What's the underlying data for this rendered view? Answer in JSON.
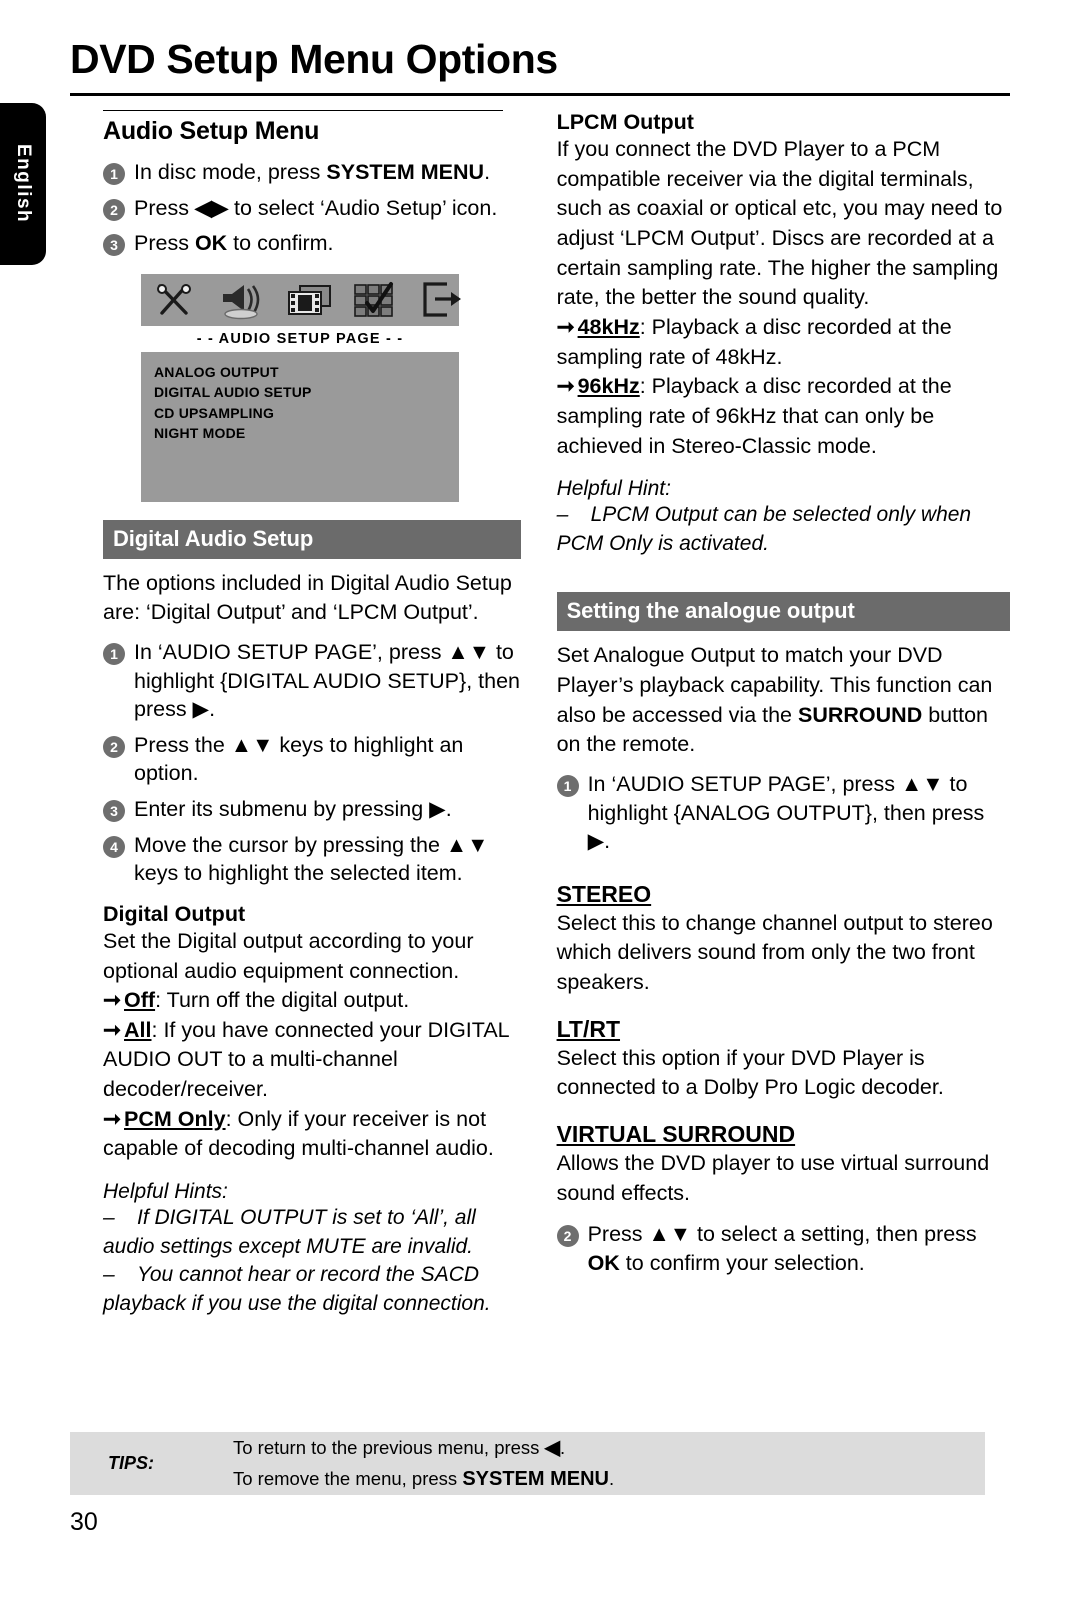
{
  "language_tab": "English",
  "page": {
    "title": "DVD Setup Menu Options",
    "number": "30"
  },
  "left_column": {
    "section_title": "Audio Setup Menu",
    "steps": [
      {
        "num": "1",
        "text": "In disc mode, press SYSTEM MENU."
      },
      {
        "num": "2",
        "text": "Press ◀▶ to select ‘Audio Setup’ icon."
      },
      {
        "num": "3",
        "text": "Press OK to confirm."
      }
    ],
    "osd": {
      "icons": [
        "tools-icon",
        "speaker-icon",
        "film-icon",
        "preferences-grid-icon",
        "exit-arrow-icon"
      ],
      "title": "- -  AUDIO  SETUP  PAGE  - -",
      "items": [
        "ANALOG OUTPUT",
        "DIGITAL AUDIO SETUP",
        "CD UPSAMPLING",
        "NIGHT MODE"
      ]
    },
    "band_digital_audio_setup": "Digital Audio Setup",
    "intro": "The options included in Digital Audio Setup are: ‘Digital Output’ and ‘LPCM Output’.",
    "steps2": [
      {
        "num": "1",
        "text": "In ‘AUDIO SETUP PAGE’, press ▲▼ to highlight {DIGITAL AUDIO SETUP}, then press ▶."
      },
      {
        "num": "2",
        "text": "Press the ▲▼ keys to highlight an option."
      },
      {
        "num": "3",
        "text": "Enter its submenu by pressing ▶."
      },
      {
        "num": "4",
        "text": "Move the cursor by pressing the ▲▼ keys to highlight the selected item."
      }
    ],
    "digital_output": {
      "heading": "Digital Output",
      "body": "Set the Digital output according to your optional audio equipment connection.",
      "options": [
        {
          "term": "Off",
          "desc": ": Turn off the digital output."
        },
        {
          "term": "All",
          "desc": ": If you have connected your DIGITAL AUDIO OUT to a multi-channel decoder/receiver."
        },
        {
          "term": "PCM Only",
          "desc": ": Only if your receiver is not capable of decoding multi-channel audio."
        }
      ]
    },
    "hints": {
      "title": "Helpful Hints:",
      "lines": [
        "If DIGITAL OUTPUT is set to ‘All’, all audio settings except MUTE are invalid.",
        "You cannot hear or record the SACD playback if you use the digital connection."
      ]
    }
  },
  "right_column": {
    "lpcm": {
      "heading": "LPCM Output",
      "body": "If you connect the DVD Player to a PCM compatible receiver via the digital terminals, such as coaxial or optical etc, you may need to adjust ‘LPCM Output’. Discs are recorded at a certain sampling rate. The higher the sampling rate, the better the sound quality.",
      "options": [
        {
          "term": "48kHz",
          "desc": ": Playback a disc recorded at the sampling rate of 48kHz."
        },
        {
          "term": "96kHz",
          "desc": ": Playback a disc recorded at the sampling rate of 96kHz that can only be achieved in Stereo-Classic mode."
        }
      ],
      "hint_title": "Helpful Hint:",
      "hint_line": "LPCM Output can be selected only when PCM Only is activated."
    },
    "band_analogue": "Setting the analogue output",
    "analogue_intro_1": "Set Analogue Output to match your DVD Player’s playback capability.  This function can also be accessed via the ",
    "analogue_intro_bold": "SURROUND",
    "analogue_intro_2": " button on the remote.",
    "step1": {
      "num": "1",
      "text": "In ‘AUDIO SETUP PAGE’, press ▲▼ to highlight {ANALOG OUTPUT}, then press ▶."
    },
    "modes": [
      {
        "name": "STEREO",
        "desc": "Select this to change channel output to stereo which delivers sound from only the two front speakers."
      },
      {
        "name": "LT/RT",
        "desc": "Select this option if your DVD Player is connected to a Dolby Pro Logic decoder."
      },
      {
        "name": "VIRTUAL SURROUND",
        "desc": "Allows the DVD player to use virtual surround sound effects."
      }
    ],
    "step2": {
      "num": "2",
      "text_1": "Press ▲▼  to select a setting, then press ",
      "text_bold": "OK",
      "text_2": " to confirm your selection."
    }
  },
  "tips": {
    "label": "TIPS:",
    "line1_a": "To return to the previous menu, press ",
    "line1_arrow": "◀",
    "line1_b": ".",
    "line2_a": "To remove the menu, press ",
    "line2_bold": "SYSTEM MENU",
    "line2_b": "."
  }
}
